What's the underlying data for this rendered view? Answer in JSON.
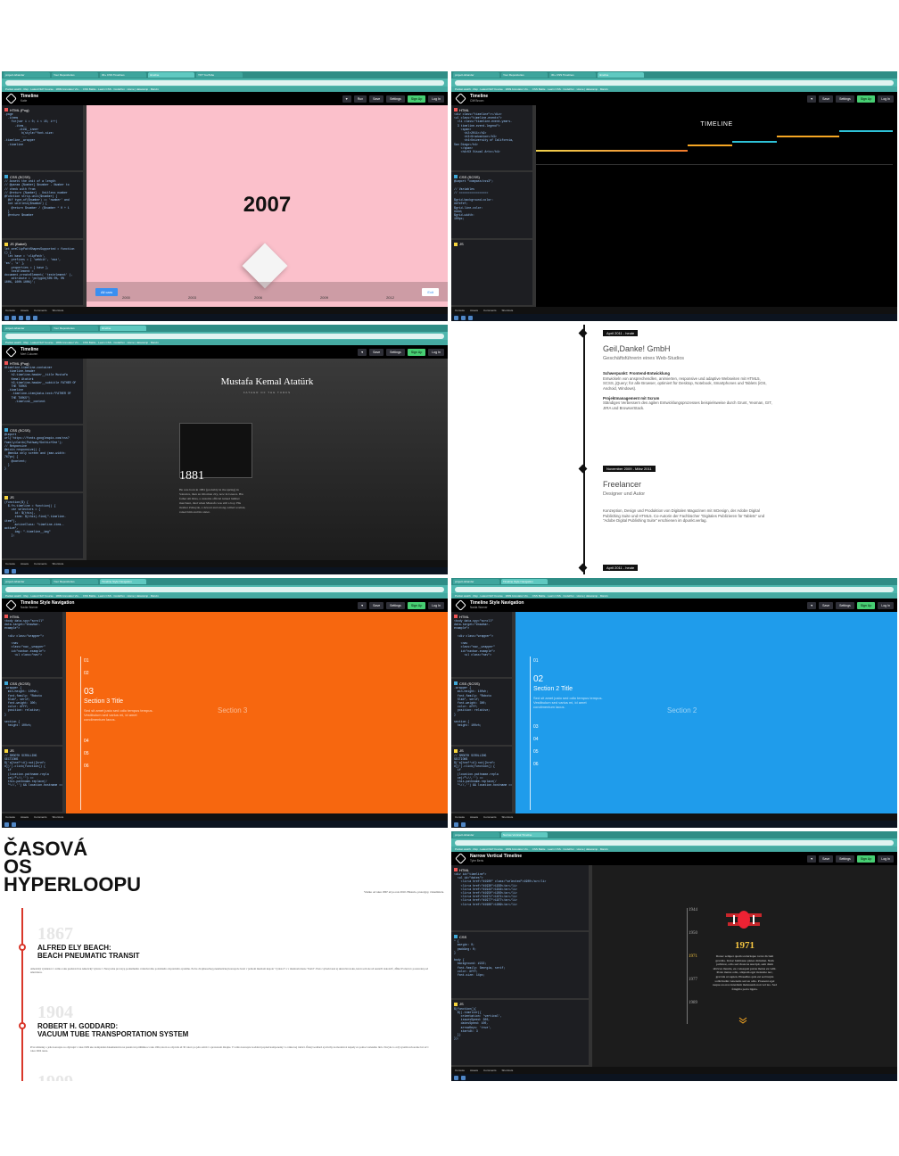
{
  "browser": {
    "tabs": [
      "project-isbander",
      "Your Repositories",
      "30+ CSS Timelines",
      "timeline",
      "YFT YouTube"
    ],
    "bookmarks": "Pocket watch · Rsp · Latest NLP Course · 1809 Annotator Viv... · CSS Battle · Learn CSS · CodePen · Home | datacamp · Marvin"
  },
  "codepen": {
    "actions": {
      "love": "♥",
      "run": "Run",
      "save": "Save",
      "settings": "Settings",
      "signup": "Sign Up",
      "login": "Log In"
    },
    "editors": {
      "html": "HTML (Pug)",
      "html2": "HTML",
      "css": "CSS (SCSS)",
      "css2": "CSS",
      "js": "JS (Babel)",
      "js2": "JS"
    },
    "status": [
      "Console",
      "Assets",
      "Comments",
      "Shortcuts"
    ]
  },
  "panel1": {
    "title": "Timeline",
    "author": "Katie",
    "year": "2007",
    "years": [
      "2000",
      "2003",
      "2006",
      "2009",
      "2012"
    ],
    "left_btn": "All cars",
    "right_btn": "Exit",
    "code_html": ".page\n  .items\n    for(var i = 0; i < 15; i++)\n      .item__\n        .item__inner\n          h(style=\"font-size:\n          ...\n.timeline__wrapper\n  .timeline",
    "code_css": "// Assets the unit of a length\n// @param {Number} $number - Number to\n// check with from\n// @return {Number} - Unitless number\n@function strip-unit($number) {\n  @if type-of($number) == 'number' and\n  not unitless($number) {\n    @return $number / ($number * 0 + 1\n  }\n  @return $number",
    "code_js": "let areClipPathShapesSupported = function\n() {\n  let base = 'clipPath',\n    prefixes = [ 'webkit', 'moz',\n'ms', 'o' ],\n    properties = [ base ],\n    testElement =\ndocument.createElement( 'testelement' ),\n    attribute = 'polygon(50% 0%, 0%\n100%, 100% 100%)';"
  },
  "panel2": {
    "title": "Timeline",
    "author": "Cliff Brown",
    "heading": "TIMELINE",
    "code_html": "<div class=\"timeline\"></div>\n<ul class=\"timeline-events\">\n  <li class=\"timeline-event-years-\n  3 timeline-event-legend\">\n    <span>\n      <h2>2011</h2>\n      <h3>Graduation</h3>\n      <h4>University of California,\nSan Diego</h4>\n    </span>\n    <h4>UX Visual Arts</h4>",
    "code_css": "@import \"compass/css3\";\n\n// Variables\n// =================\n\n$grid-background-color:\n#efefef;\n$grid-line-color:\n#ddd;\n$grid-width:\n100px;"
  },
  "panel3": {
    "title": "Timeline",
    "author": "Mert Cukuren",
    "heading": "Mustafa Kemal Atatürk",
    "subheading": "FATHER OF THE TURKS",
    "year": "1881",
    "bio": "He was born in 1881 (probably in the spring) in Salonica, then an Ottoman city, now in Greece. His father Ali Riza, a customs official turned lumber merchant, died when Mustafa was still a boy. His mother Zubeyde, a devout and strong-willed woman, raised him and his sister.",
    "code_html": "#timeline.timeline-container\n  .timeline-header\n    h2.timeline-header__title Mustafa\n    Kemal Atatürk\n    h3.timeline-header__subtitle FATHER OF\n    THE TURKS\n  .timeline\n    .timeline-item(data-text=\"FATHER OF\n    THE TURKS\")\n      .timeline__content",
    "code_css": "@import\nurl('https://fonts.googleapis.com/css?\nfamily=Cardo|Pathway+Gothic+One');\n// Responsive\n@mixin responsive() {\n  @media only screen and (max-width:\n767px) {\n    @content;\n  }\n}",
    "code_js": "(function($) {\n  $.fn.timeline = function() {\n    var selectors = {\n      id: $(this),\n      item: $(this).find(\".timeline-\nitem\"),\n      activeClass: \"timeline-item--\nactive\",\n      img: \".timeline__img\"\n    };"
  },
  "panel4": {
    "entries": [
      {
        "badge": "April 2011 - heute",
        "company": "Geil,Danke! GmbH",
        "role": "Geschäftsführerin eines Web-Studios",
        "h1": "Schwerpunkt: Frontend-Entwicklung",
        "p1": "Entwickeln von ansprechendlen, animierten, responsive und adaptive Webseiten mit HTML5, SCSS, jQuery; für alle Browser, optimiert für Desktop, Notebook, Smartphones und Tablets (iOS, Android, Windows).",
        "h2": "Projektmanagement mit Scrum",
        "p2": "Ständiges Verbessern des agilen Entwicklungsprozesses beispielsweise durch Grunt, Yeoman, GIT, JIRA und BrowserStack."
      },
      {
        "badge": "November 2009 - März 2011",
        "company": "Freelancer",
        "role": "Designer und Autor",
        "p1": "Konzeption, Design und Produktion von Digitalen Magazinen mit InDesign, der Adobe Digital Publishing Suite und HTML5. Co-Autorin der Fachbücher \"Digitales Publizieren für Tablets\" und \"Adobe Digital Publishing Suite\" erschienen im dpunkt.verlag."
      },
      {
        "badge": "April 2011 - heute"
      }
    ]
  },
  "panel5": {
    "title": "Timeline Style Navigation",
    "author": "Nadia Warner",
    "nums": [
      "01",
      "02",
      "03",
      "04",
      "05",
      "06"
    ],
    "active_num": "03",
    "active_title": "Section 3 Title",
    "active_text": "Sed sit amet justo sed odio tempus tempus. Vestibulum sed varius mi, id amet condimentum lacus.",
    "center": "Section 3",
    "code_html": "<body data-spy=\"scroll\"\ndata-target=\"#navbar-\nexample\">\n\n  <div class=\"wrapper\">\n\n    <nav\n    class=\"nav__wrapper\"\n    id=\"navbar-example\">\n      <ul class=\"nav\">",
    "code_css": ".wrapper {\n  min-height: 100vh;\n  font-family: \"Roboto\n  Slab\", serif;\n  font-weight: 300;\n  color: #fff;\n  position: relative;\n}\n\nsection {\n  height: 100vh;",
    "code_js": "// SMOOTH SCROLLING\nSECTIONS\n$('a[href*=#]:not([href=\n#])').click(function() {\n  if\n  (location.pathname.repla\n  ce(/^\\//,'') ==\n  this.pathname.replace(/\n  ^\\//,'') && location.hostname =="
  },
  "panel6": {
    "title": "Timeline Style Navigation",
    "author": "Nadia Warner",
    "active_num": "02",
    "active_title": "Section 2 Title",
    "active_text": "Sed sit amet justo sed odio tempus tempus. Vestibulum sed varius mi, id amet condimentum lacus.",
    "center": "Section 2"
  },
  "panel7": {
    "title": "ČASOVÁ OS HYPERLOOPU",
    "title_lines": [
      "ČASOVÁ",
      "OS",
      "HYPERLOOPU"
    ],
    "lead": "Všetko od roku 1867 až po rok 2010. Historia, prototypy, vizualizácie.",
    "events": [
      {
        "year": "1867",
        "heading_1": "ALFRED ELY BEACH:",
        "heading_2": "BEACH PNEUMATIC TRANSIT",
        "text": "Americký vynálezca v tomto roku predstavil na Americký výstave v Newyorku prototyp podzemného vzduchového potrubného dopravného systému. Počas dvojmesačnej pneumatickej koncepcie hosti v jednom menšom kupole \"vyrástol\" a v dnešnom meste \"hrabí\". Preto vybudované aj skutočnú stoku, ktorú som ale už nestačil dokončiť, dĺžka 95 metrov postavenú pod americkou."
      },
      {
        "year": "1904",
        "heading_1": "ROBERT H. GODDARD:",
        "heading_2": "VACUUM TUBE TRANSPORTATION SYSTEM",
        "text": "Prvé zmienky o jeho koncepte sa objavujú v roku 1909 ako kompletnú dokumentáciu na patentovú prihlášku z roku 1904, ktorá sa objavila až 30 rokov po jeho smrti v opravenom dizajne. V tomto koncepte Goddard popísal komponenty vo vákuovej trubici. Ďalej Goddard aj návrhy na modelové nápady za pomoci zeleného lúča. Navyše to celý systém zatvorenie bol až v roku 1904 tesne."
      },
      {
        "year": "1909"
      }
    ]
  },
  "panel8": {
    "title": "Narrow Vertical Timeline",
    "author": "Tyler Beris",
    "years": [
      "1944",
      "1950",
      "1971",
      "1977",
      "1989"
    ],
    "active_year": "1971",
    "text": "Donec semper quam scelerisque tortor dictum gravida. In hac habitasse platea dictumst. Nam pulvinar, odio sed rhoncus suscipit, sem diam ultrices mauris, eu consequat purus metus eu velit. Proin metus odio, aliquam eget molestie nec, gravida ut sapien. Phasellus quis est sed turpis sollicitudin venenatis sed eu odio. Praesent eget neque eu eros interdum malesuada non vel leo. Sed fringilla porta ligula.",
    "code_html": "<div id=\"timeline\">\n  <ul id=\"dates\">\n    <li><a href=\"#1900\" class=\"selected\">1900</a></li>\n    <li><a href=\"#1930\">1930</a></li>\n    <li><a href=\"#1944\">1944</a></li>\n    <li><a href=\"#1950\">1950</a></li>\n    <li><a href=\"#1971\">1971</a></li>\n    <li><a href=\"#1977\">1977</a></li>\n    <li><a href=\"#1989\">1989</a></li>",
    "code_css": "* {\n  margin: 0;\n  padding: 0;\n}\n\nbody {\n  background: #222;\n  font-family: Georgia, serif;\n  color: #fff;\n  font-size: 14px;",
    "code_js": "$(function(){\n  $().timelinr({\n    orientation: 'vertical',\n    issuesSpeed: 300,\n    datesSpeed: 100,\n    arrowKeys: 'true',\n    startAt: 3\n  })\n});"
  },
  "colors": {
    "pink": "#fbc0cb",
    "orange": "#f7670f",
    "blue": "#1f9ceb",
    "hyper_red": "#d9372a",
    "gold": "#f5c541"
  }
}
